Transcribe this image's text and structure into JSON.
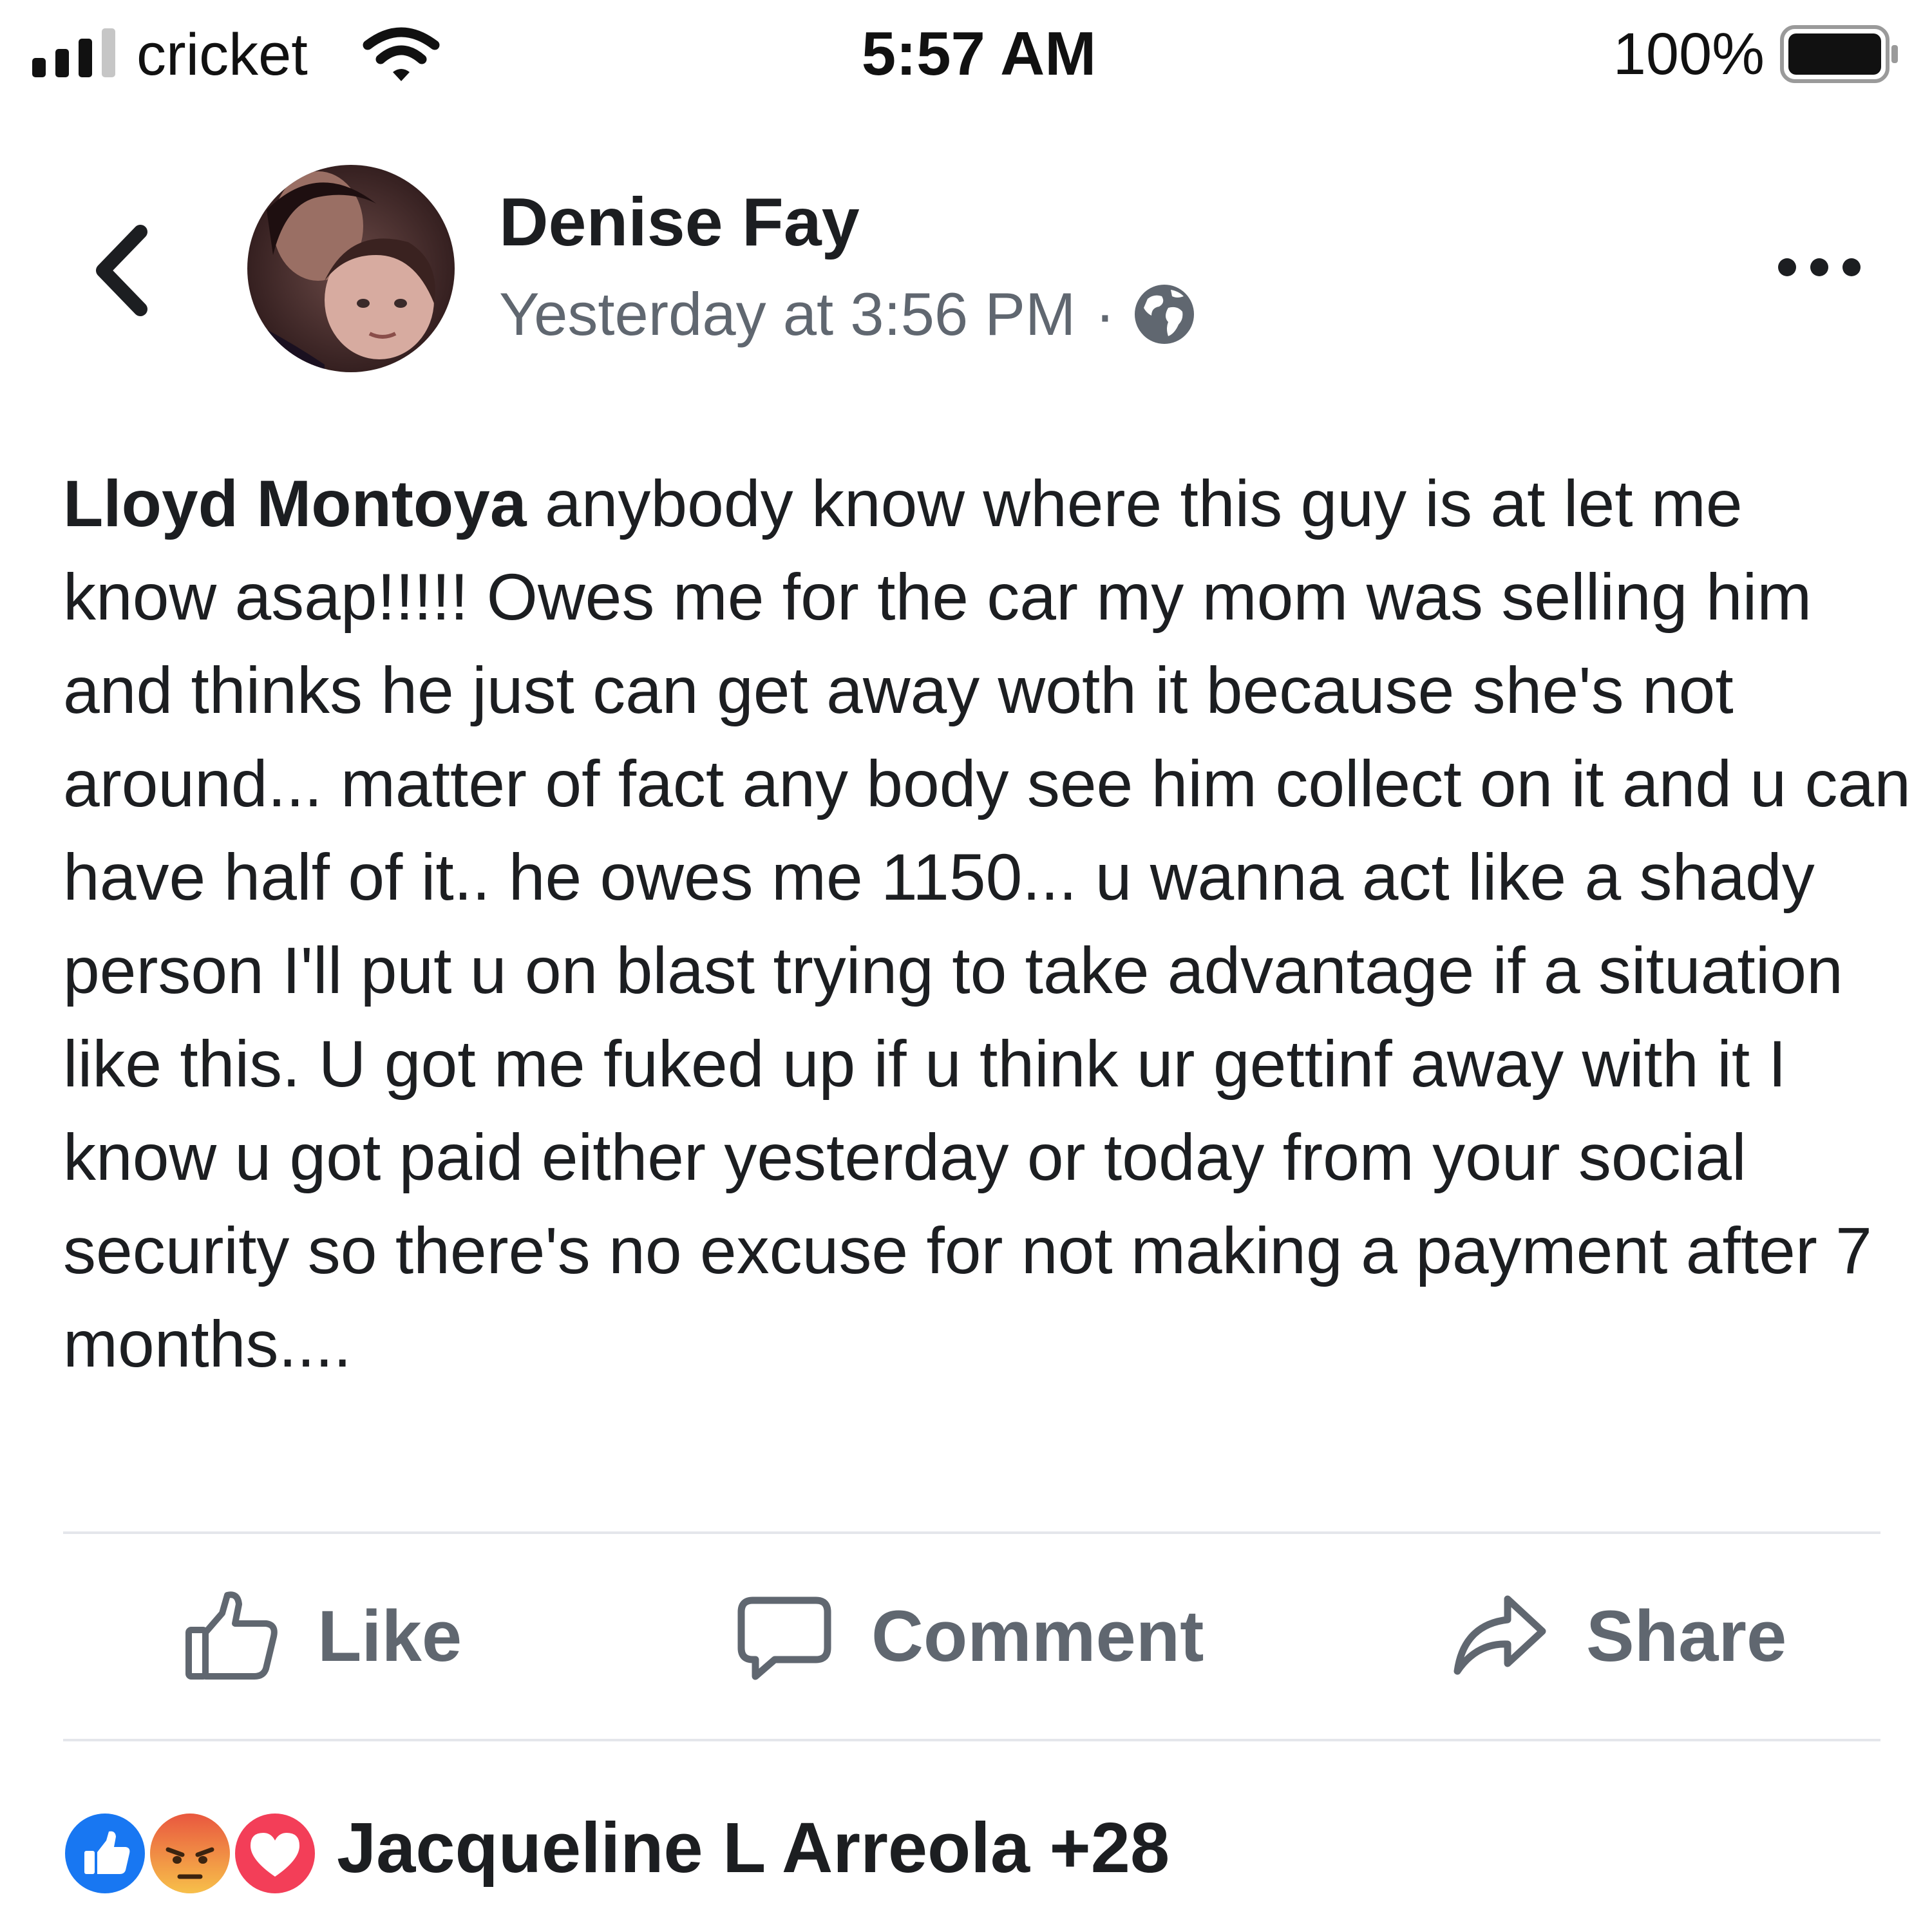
{
  "status_bar": {
    "carrier": "cricket",
    "time": "5:57 AM",
    "battery_percent": "100%",
    "signal_bars_filled": 3,
    "signal_bars_total": 4
  },
  "post": {
    "author": "Denise Fay",
    "timestamp": "Yesterday at 3:56 PM",
    "separator": "·",
    "privacy_icon": "globe-icon",
    "tagged_name": "Lloyd Montoya",
    "text": " anybody know where this guy is at let me know asap!!!!!  Owes me for the car my mom was selling him and thinks he just can get away woth it because she's not around... matter of fact any body see him collect on it and u can have half of it.. he owes me 1150... u wanna act like a shady person I'll put u on blast  trying to take advantage if a situation like this. U got me fuked  up if u think ur gettinf away with it I know u got paid either yesterday or today from your social security so there's no excuse for not making a payment after 7 months...."
  },
  "actions": {
    "like": "Like",
    "comment": "Comment",
    "share": "Share"
  },
  "reactions": {
    "icons": [
      "like-reaction-icon",
      "angry-reaction-icon",
      "love-reaction-icon"
    ],
    "summary": "Jacqueline L Arreola +28"
  },
  "colors": {
    "text_primary": "#1c1e21",
    "text_secondary": "#606770",
    "divider": "#e4e6eb",
    "like_blue": "#1877f2",
    "angry_orange": "#f0a24a",
    "love_red": "#f33e58"
  }
}
